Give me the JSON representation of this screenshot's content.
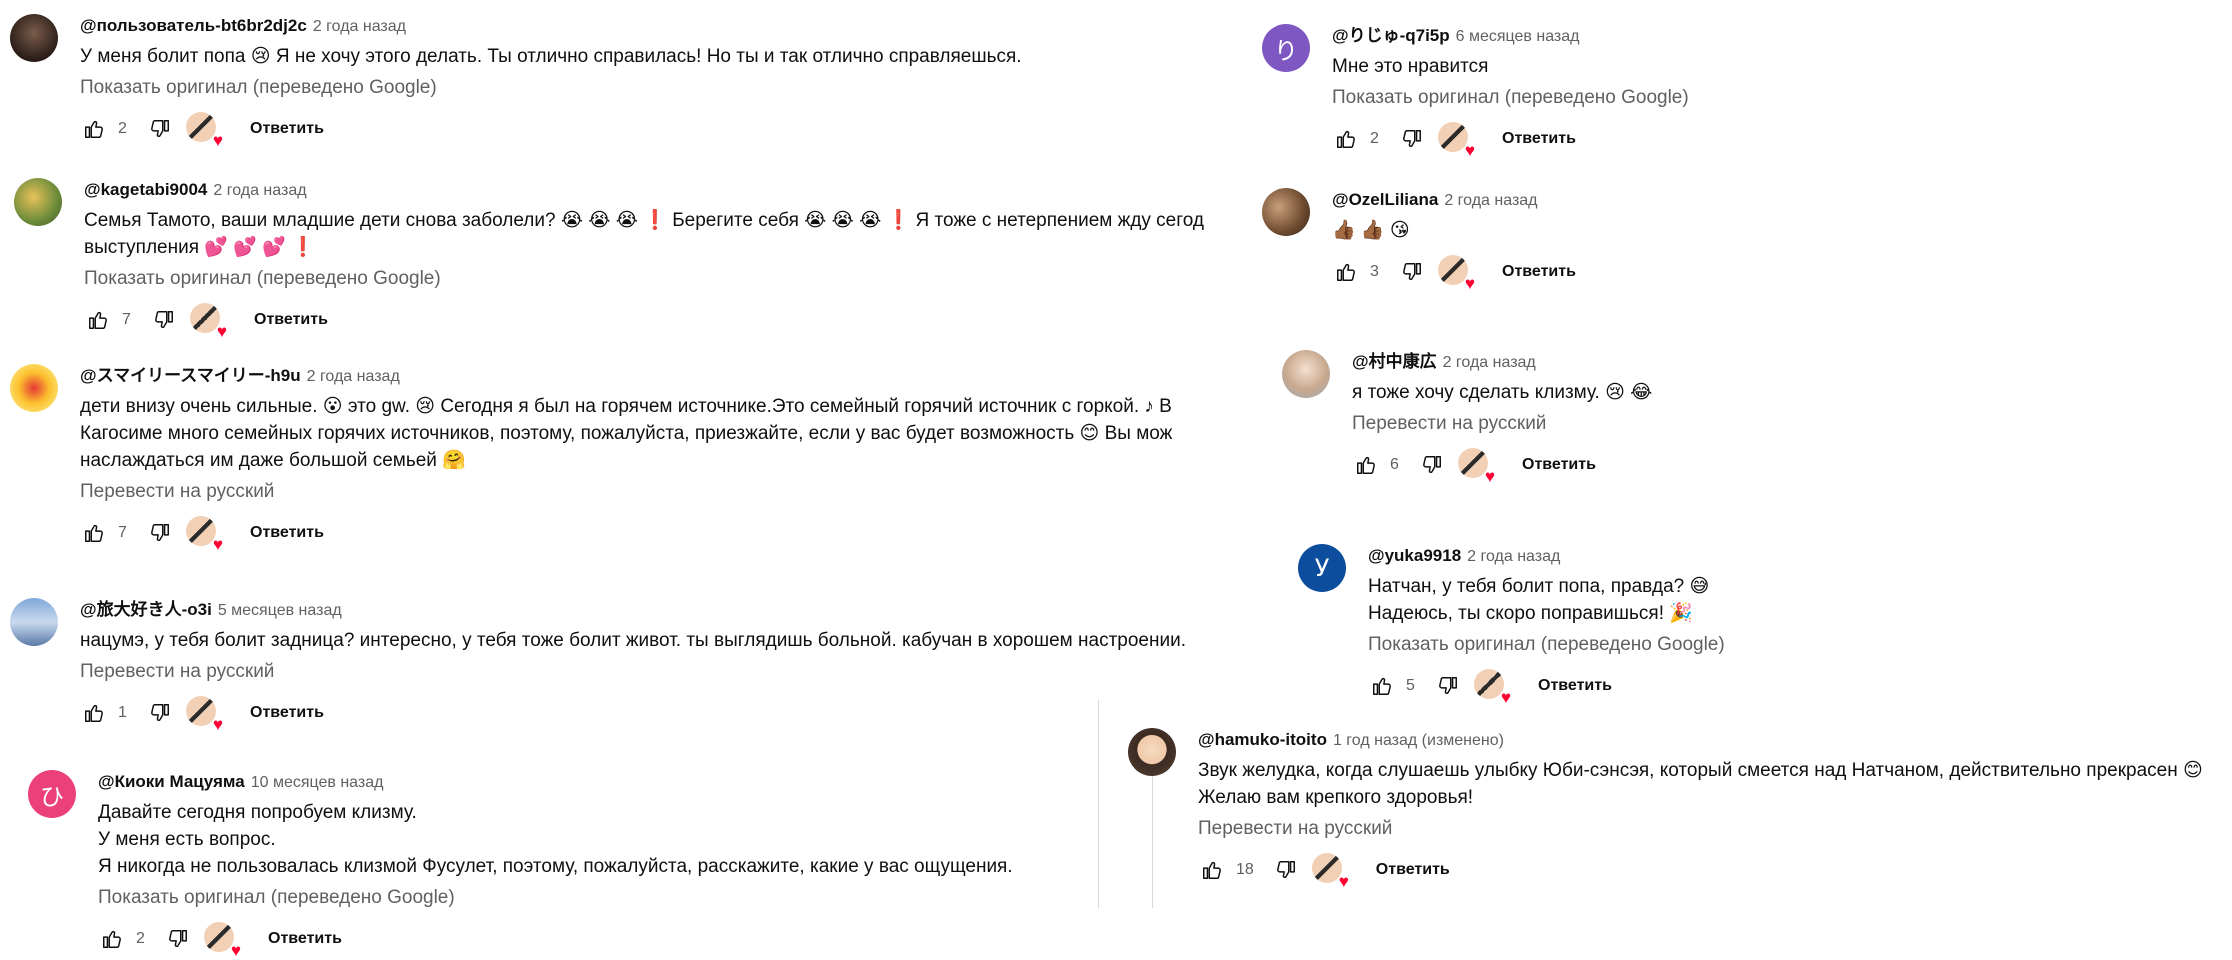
{
  "ui": {
    "reply_label": "Ответить",
    "icons": {
      "like": "thumb-up-icon",
      "dislike": "thumb-down-icon",
      "heart": "creator-heart-icon"
    },
    "colors": {
      "secondary_text": "#606060",
      "heart": "#ff0033",
      "avatar_pink": "#ec407a",
      "avatar_purple": "#7e57c2",
      "avatar_blue": "#0d4d9e"
    }
  },
  "comments": [
    {
      "author": "@пользователь-bt6br2dj2c",
      "time": "2 года назад",
      "lines": [
        "У меня болит попа 😢 Я не хочу этого делать. Ты отлично справилась! Но ты и так отлично справляешься."
      ],
      "translate": "Показать оригинал (переведено Google)",
      "likes": "2"
    },
    {
      "author": "@kagetabi9004",
      "time": "2 года назад",
      "lines": [
        "Семья Тамото, ваши младшие дети снова заболели? 😭 😭 😭 ❗ Берегите себя 😭 😭 😭 ❗ Я тоже с нетерпением жду сегодн",
        "выступления 💕 💕 💕 ❗"
      ],
      "translate": "Показать оригинал (переведено Google)",
      "likes": "7"
    },
    {
      "author": "@スマイリースマイリー-h9u",
      "time": "2 года назад",
      "lines": [
        "дети внизу очень сильные. 😮 это gw. 😢 Сегодня я был на горячем источнике.Это семейный горячий источник с горкой. ♪ В",
        "Кагосиме много семейных горячих источников, поэтому, пожалуйста, приезжайте, если у вас будет возможность 😊 Вы мож",
        "наслаждаться им даже большой семьей 🤗"
      ],
      "translate": "Перевести на русский",
      "likes": "7"
    },
    {
      "author": "@旅大好き人-o3i",
      "time": "5 месяцев назад",
      "lines": [
        "нацумэ, у тебя болит задница? интересно, у тебя тоже болит живот. ты выглядишь больной. кабучан в хорошем настроении."
      ],
      "translate": "Перевести на русский",
      "likes": "1"
    },
    {
      "author": "@Киоки Мацуяма",
      "time": "10 месяцев назад",
      "avatar_letter": "ひ",
      "lines": [
        "Давайте сегодня попробуем клизму.",
        "У меня есть вопрос.",
        "Я никогда не пользовалась клизмой Фусулет, поэтому, пожалуйста, расскажите, какие у вас ощущения."
      ],
      "translate": "Показать оригинал (переведено Google)",
      "likes": "2"
    },
    {
      "author": "@りじゅ-q7i5p",
      "time": "6 месяцев назад",
      "avatar_letter": "り",
      "lines": [
        "Мне это нравится"
      ],
      "translate": "Показать оригинал (переведено Google)",
      "likes": "2"
    },
    {
      "author": "@OzelLiliana",
      "time": "2 года назад",
      "lines": [
        "👍🏾 👍🏾 😘"
      ],
      "translate": "",
      "likes": "3"
    },
    {
      "author": "@村中康広",
      "time": "2 года назад",
      "lines": [
        "я тоже хочу сделать клизму. 😢 😂"
      ],
      "translate": "Перевести на русский",
      "likes": "6"
    },
    {
      "author": "@yuka9918",
      "time": "2 года назад",
      "avatar_letter": "У",
      "lines": [
        "Натчан, у тебя болит попа, правда? 😅",
        "Надеюсь, ты скоро поправишься! 🎉"
      ],
      "translate": "Показать оригинал (переведено Google)",
      "likes": "5"
    },
    {
      "author": "@hamuko-itoito",
      "time": "1 год назад (изменено)",
      "lines": [
        "Звук желудка, когда слушаешь улыбку Юби-сэнсэя, который смеется над Натчаном, действительно прекрасен 😊",
        "Желаю вам крепкого здоровья!"
      ],
      "translate": "Перевести на русский",
      "likes": "18"
    }
  ]
}
